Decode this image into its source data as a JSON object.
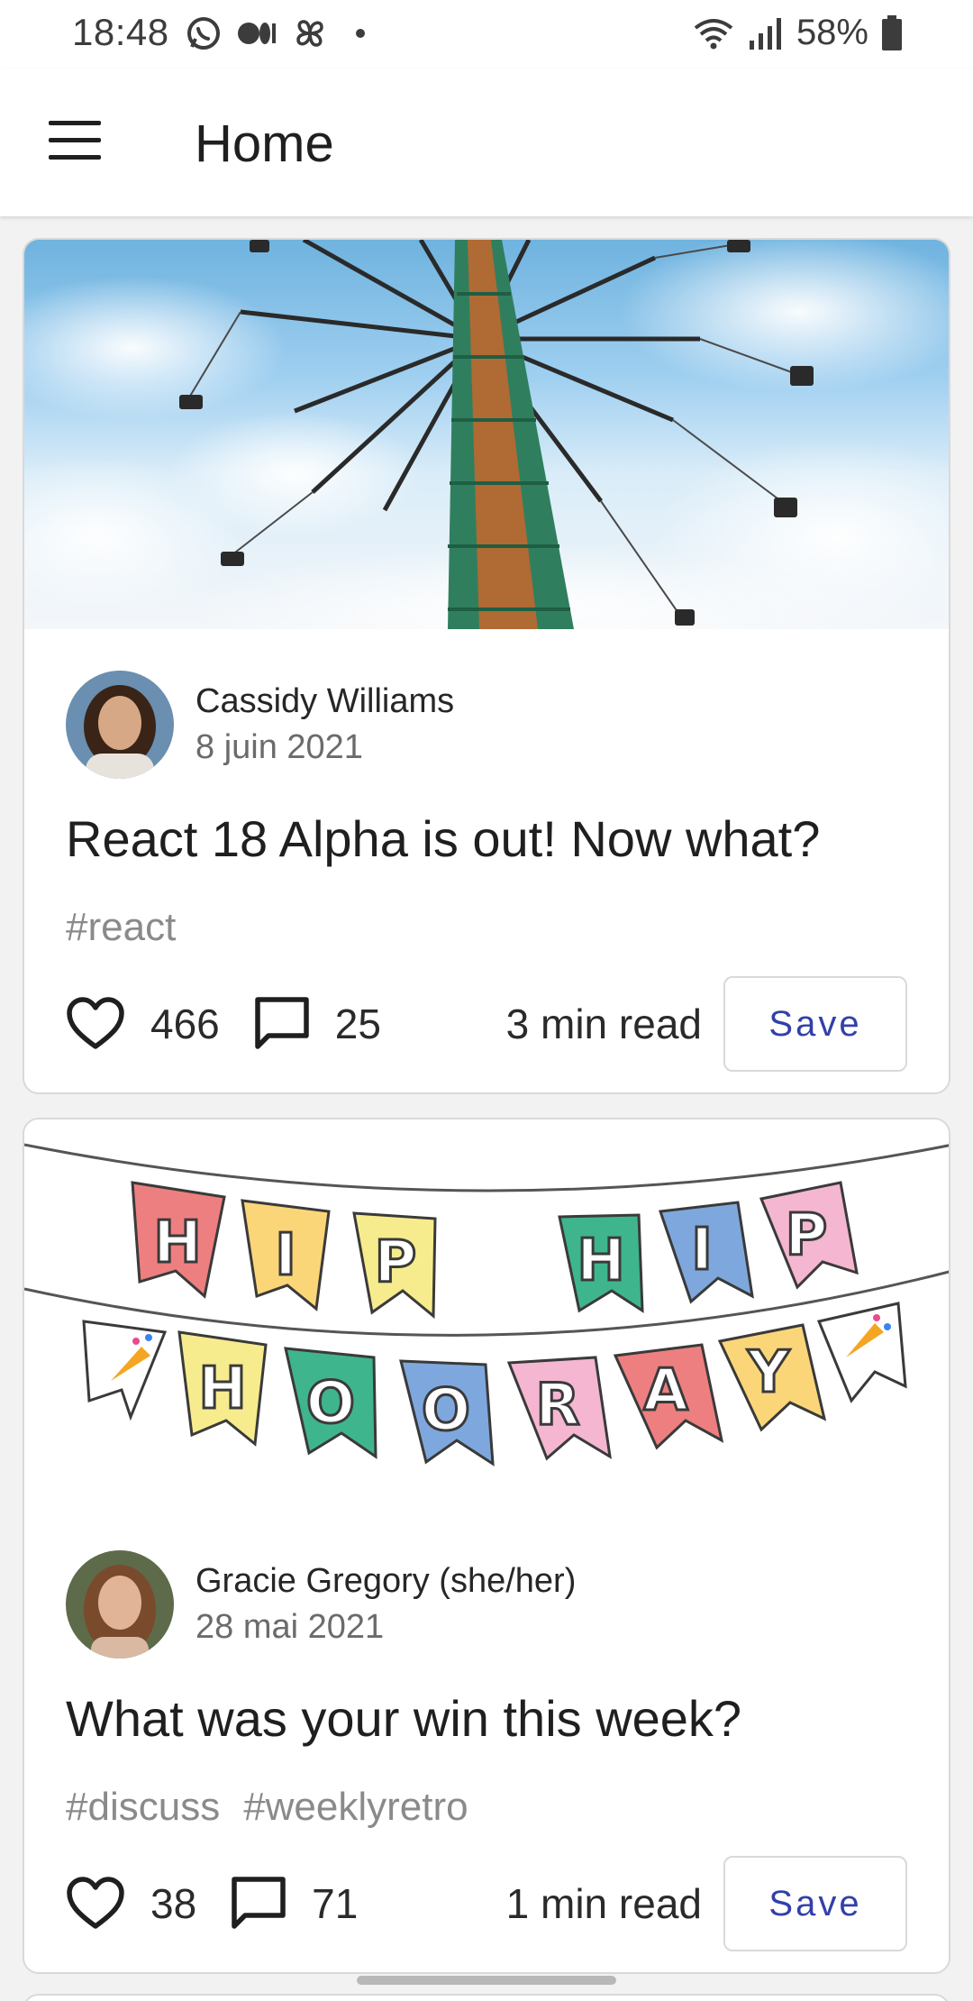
{
  "status_bar": {
    "time": "18:48",
    "battery": "58%",
    "icons_left": [
      "whatsapp-icon",
      "medium-icon",
      "pinwheel-icon",
      "notification-dot"
    ],
    "icons_right": [
      "wifi-icon",
      "signal-icon",
      "battery-icon"
    ]
  },
  "app_bar": {
    "title": "Home"
  },
  "posts": [
    {
      "author": "Cassidy Williams",
      "date": "8 juin 2021",
      "title": "React 18 Alpha is out! Now what?",
      "tags": [
        "#react"
      ],
      "reactions": "466",
      "comments": "25",
      "read_time": "3 min read",
      "save_label": "Save"
    },
    {
      "author": "Gracie Gregory (she/her)",
      "date": "28 mai 2021",
      "title": "What was your win this week?",
      "tags": [
        "#discuss",
        "#weeklyretro"
      ],
      "reactions": "38",
      "comments": "71",
      "read_time": "1 min read",
      "save_label": "Save"
    }
  ],
  "colors": {
    "accent": "#3240a8",
    "card_border": "#d9d9d9",
    "muted_text": "#8a8a8a"
  }
}
